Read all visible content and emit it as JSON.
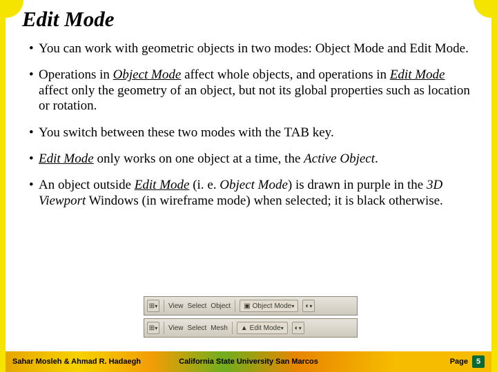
{
  "title": "Edit Mode",
  "bullets": {
    "b1": "You can work with geometric objects in two modes: Object Mode and Edit Mode.",
    "b2a": "Operations in ",
    "b2b": "Object Mode",
    "b2c": " affect whole objects, and operations in ",
    "b2d": "Edit Mode",
    "b2e": " affect only the geometry of an object, but not its global properties such as location or rotation.",
    "b3": "You switch between these two modes with the TAB key.",
    "b4a": "Edit Mode",
    "b4b": " only works on one object at a time, the ",
    "b4c": "Active Object",
    "b4d": ".",
    "b5a": "An object outside ",
    "b5b": "Edit Mode",
    "b5c": " (i. e. ",
    "b5d": "Object Mode",
    "b5e": ") is drawn in purple in the ",
    "b5f": "3D Viewport",
    "b5g": " Windows (in wireframe mode) when selected; it is black otherwise."
  },
  "toolbar1": {
    "menu_view": "View",
    "menu_select": "Select",
    "menu_object": "Object",
    "mode": "Object Mode"
  },
  "toolbar2": {
    "menu_view": "View",
    "menu_select": "Select",
    "menu_mesh": "Mesh",
    "mode": "Edit Mode"
  },
  "footer": {
    "left": "Sahar Mosleh & Ahmad R. Hadaegh",
    "center": "California State University San Marcos",
    "page_label": "Page",
    "page_number": "5"
  }
}
